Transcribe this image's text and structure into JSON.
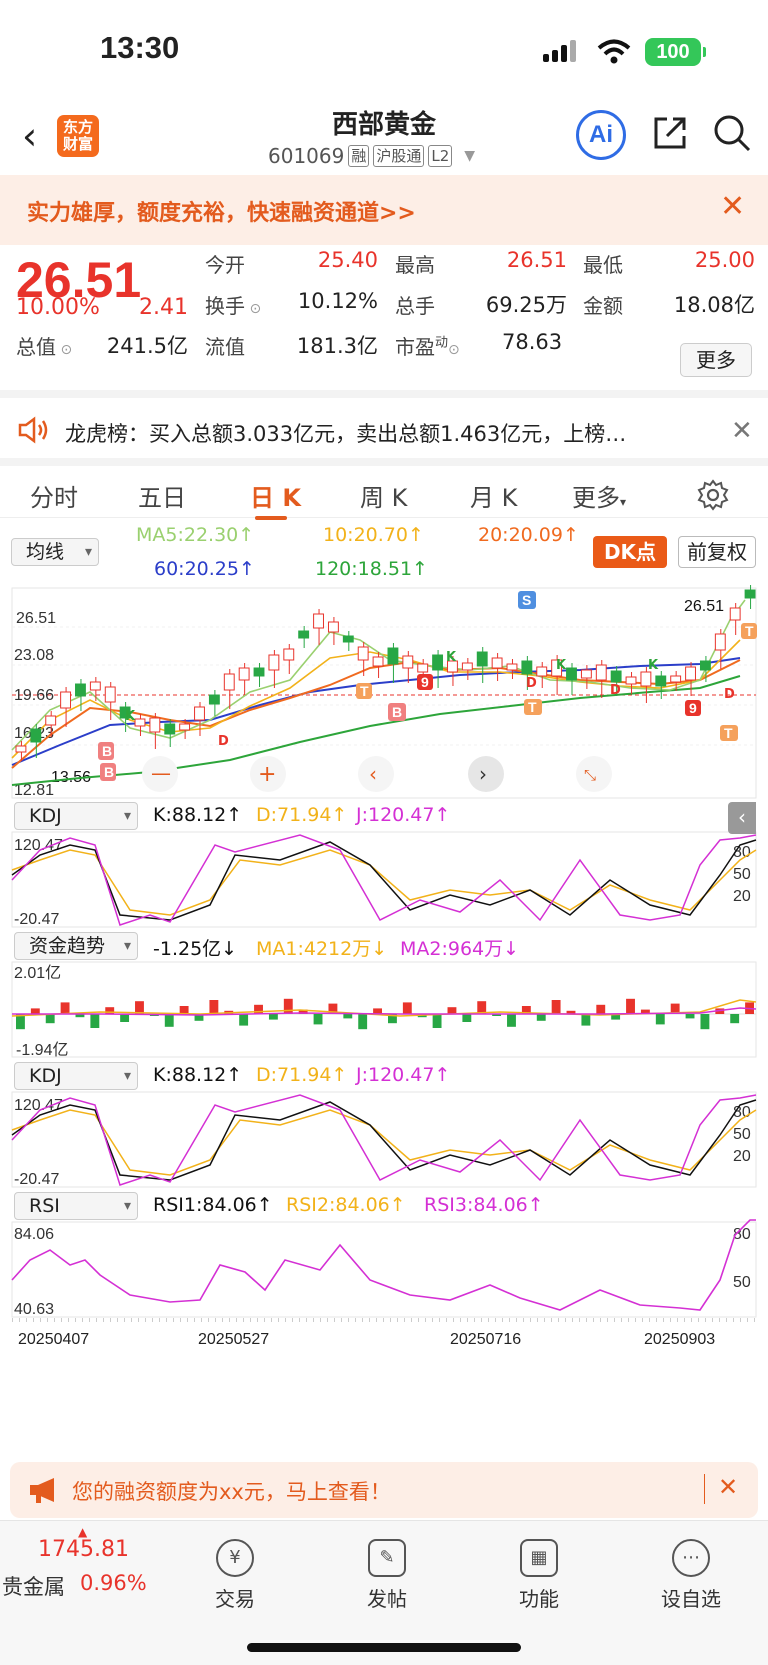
{
  "status": {
    "time": "13:30",
    "battery": "100"
  },
  "nav": {
    "logo": "东方\n财富",
    "name": "西部黄金",
    "code": "601069",
    "tags": [
      "融",
      "沪股通",
      "L2"
    ],
    "ai_label": "Ai"
  },
  "promo": {
    "text": "实力雄厚，额度充裕，快速融资通道>>",
    "close": "✕"
  },
  "quote": {
    "price": "26.51",
    "change_pct": "10.00%",
    "change": "2.41",
    "open_label": "今开",
    "open": "25.40",
    "high_label": "最高",
    "high": "26.51",
    "low_label": "最低",
    "low": "25.00",
    "turnover_label": "换手",
    "turnover": "10.12%",
    "volume_label": "总手",
    "volume": "69.25万",
    "amount_label": "金额",
    "amount": "18.08亿",
    "mcap_label": "总值",
    "mcap": "241.5亿",
    "float_label": "流值",
    "float": "181.3亿",
    "pe_label": "市盈",
    "pe_sup": "动",
    "pe": "78.63",
    "more": "更多"
  },
  "lhb": {
    "text": "龙虎榜：买入总额3.033亿元，卖出总额1.463亿元，上榜…",
    "close": "✕"
  },
  "tabs": [
    "分时",
    "五日",
    "日 K",
    "周 K",
    "月 K",
    "更多"
  ],
  "active_tab": "日 K",
  "ma": {
    "selector": "均线",
    "ma5": "MA5:22.30↑",
    "ma10": "10:20.70↑",
    "ma20": "20:20.09↑",
    "ma60": "60:20.25↑",
    "ma120": "120:18.51↑",
    "dk": "DK点",
    "fq": "前复权",
    "colors": {
      "ma5": "#9ad06f",
      "ma10": "#f2b21a",
      "ma20": "#f06a1f",
      "ma60": "#2b3ec9",
      "ma120": "#2da53a"
    }
  },
  "kline": {
    "y_ticks": [
      "26.51",
      "23.08",
      "19.66",
      "16.23",
      "12.81"
    ],
    "last_label": "26.51",
    "low_label": "13.56"
  },
  "kdj1": {
    "selector": "KDJ",
    "k": "K:88.12↑",
    "d": "D:71.94↑",
    "j": "J:120.47↑",
    "top": "120.47",
    "bottom": "-20.47",
    "levels": [
      "80",
      "50",
      "20"
    ]
  },
  "flow": {
    "selector": "资金趋势",
    "value": "-1.25亿↓",
    "ma1": "MA1:4212万↓",
    "ma2": "MA2:964万↓",
    "top": "2.01亿",
    "bottom": "-1.94亿"
  },
  "kdj2": {
    "selector": "KDJ",
    "k": "K:88.12↑",
    "d": "D:71.94↑",
    "j": "J:120.47↑",
    "top": "120.47",
    "bottom": "-20.47",
    "levels": [
      "80",
      "50",
      "20"
    ]
  },
  "rsi": {
    "selector": "RSI",
    "rsi1": "RSI1:84.06↑",
    "rsi2": "RSI2:84.06↑",
    "rsi3": "RSI3:84.06↑",
    "top": "84.06",
    "bottom": "40.63",
    "levels": [
      "80",
      "50"
    ]
  },
  "dates": [
    "20250407",
    "20250527",
    "20250716",
    "20250903"
  ],
  "banner2": {
    "text": "您的融资额度为xx元，马上查看！"
  },
  "bottom": {
    "index_value": "1745.81",
    "index_name": "贵金属",
    "index_pct": "0.96%",
    "items": [
      "交易",
      "发帖",
      "功能",
      "设自选"
    ]
  }
}
